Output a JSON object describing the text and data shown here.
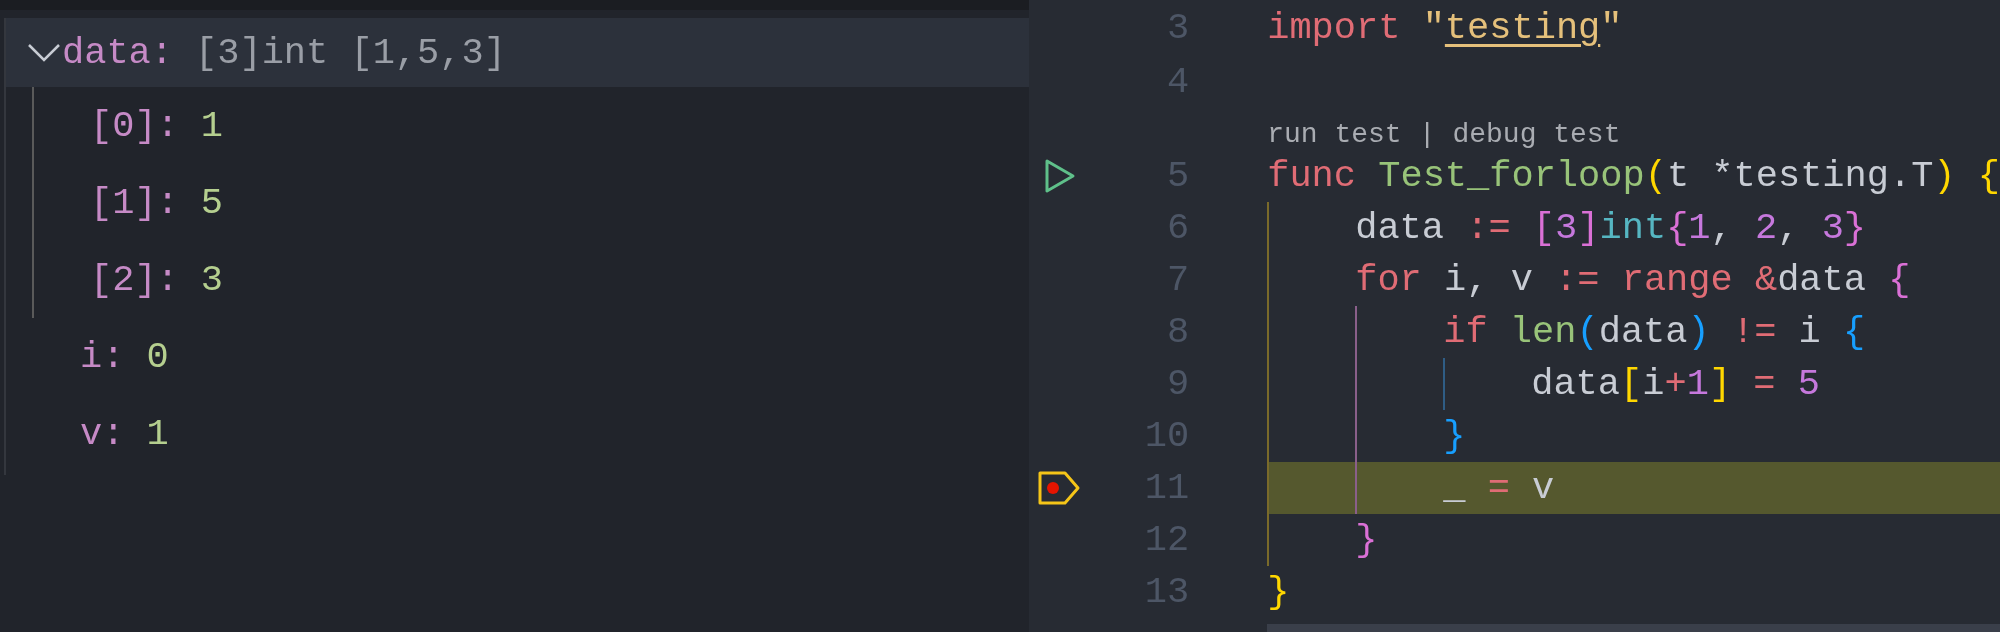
{
  "variables": [
    {
      "name": "data:",
      "value": "[3]int [1,5,3]",
      "kind": "summary",
      "expanded": true,
      "selected": true,
      "children": [
        {
          "name": "[0]:",
          "value": "1",
          "kind": "number",
          "selected": false
        },
        {
          "name": "[1]:",
          "value": "5",
          "kind": "number",
          "selected": false
        },
        {
          "name": "[2]:",
          "value": "3",
          "kind": "number",
          "selected": false
        }
      ]
    },
    {
      "name": "i:",
      "value": "0",
      "kind": "number",
      "selected": false
    },
    {
      "name": "v:",
      "value": "1",
      "kind": "number",
      "selected": false
    }
  ],
  "editor": {
    "lines": [
      {
        "number": "3",
        "tokens": [
          {
            "text": "import ",
            "kind": "keyword"
          },
          {
            "text": "\"",
            "kind": "string"
          },
          {
            "text": "testing",
            "kind": "link"
          },
          {
            "text": "\"",
            "kind": "string"
          }
        ]
      },
      {
        "number": "4"
      },
      {
        "kind": "codelens",
        "items": [
          {
            "text": "run test",
            "kind": "link"
          },
          {
            "text": "|",
            "kind": "separator"
          },
          {
            "text": "debug test",
            "kind": "link"
          }
        ]
      },
      {
        "number": "5",
        "runnable": true,
        "tokens": [
          {
            "text": "func ",
            "kind": "keyword"
          },
          {
            "text": "Test_forloop",
            "kind": "function"
          },
          {
            "text": "(",
            "kind": "bracket1"
          },
          {
            "text": "t *testing.T",
            "kind": "plain"
          },
          {
            "text": ")",
            "kind": "bracket1"
          },
          {
            "text": " {",
            "kind": "bracket1"
          }
        ],
        "children": [
          {
            "number": "6",
            "tokens": [
              {
                "text": "data ",
                "kind": "plain"
              },
              {
                "text": ":= ",
                "kind": "operator"
              },
              {
                "text": "[",
                "kind": "bracket2"
              },
              {
                "text": "3",
                "kind": "number"
              },
              {
                "text": "]",
                "kind": "bracket2"
              },
              {
                "text": "int",
                "kind": "type"
              },
              {
                "text": "{",
                "kind": "bracket2"
              },
              {
                "text": "1",
                "kind": "number"
              },
              {
                "text": ", ",
                "kind": "plain"
              },
              {
                "text": "2",
                "kind": "number"
              },
              {
                "text": ", ",
                "kind": "plain"
              },
              {
                "text": "3",
                "kind": "number"
              },
              {
                "text": "}",
                "kind": "bracket2"
              }
            ]
          },
          {
            "number": "7",
            "tokens": [
              {
                "text": "for",
                "kind": "keyword"
              },
              {
                "text": " i, v ",
                "kind": "plain"
              },
              {
                "text": ":= ",
                "kind": "operator"
              },
              {
                "text": "range ",
                "kind": "keyword"
              },
              {
                "text": "&",
                "kind": "operator"
              },
              {
                "text": "data ",
                "kind": "plain"
              },
              {
                "text": "{",
                "kind": "bracket2"
              }
            ],
            "children": [
              {
                "number": "8",
                "tokens": [
                  {
                    "text": "if ",
                    "kind": "keyword"
                  },
                  {
                    "text": "len",
                    "kind": "function"
                  },
                  {
                    "text": "(",
                    "kind": "bracket3"
                  },
                  {
                    "text": "data",
                    "kind": "plain"
                  },
                  {
                    "text": ") ",
                    "kind": "bracket3"
                  },
                  {
                    "text": "!=",
                    "kind": "operator"
                  },
                  {
                    "text": " i ",
                    "kind": "plain"
                  },
                  {
                    "text": "{",
                    "kind": "bracket3"
                  }
                ],
                "children": [
                  {
                    "number": "9",
                    "tokens": [
                      {
                        "text": "data",
                        "kind": "plain"
                      },
                      {
                        "text": "[",
                        "kind": "bracket1"
                      },
                      {
                        "text": "i",
                        "kind": "plain"
                      },
                      {
                        "text": "+",
                        "kind": "operator"
                      },
                      {
                        "text": "1",
                        "kind": "number"
                      },
                      {
                        "text": "] ",
                        "kind": "bracket1"
                      },
                      {
                        "text": "= ",
                        "kind": "operator"
                      },
                      {
                        "text": "5",
                        "kind": "number"
                      }
                    ]
                  }
                ]
              },
              {
                "number": "10",
                "tokens": [
                  {
                    "text": "}",
                    "kind": "bracket3"
                  }
                ]
              },
              {
                "number": "11",
                "paused": true,
                "tokens": [
                  {
                    "text": "_ ",
                    "kind": "plain"
                  },
                  {
                    "text": "=",
                    "kind": "operator"
                  },
                  {
                    "text": " v",
                    "kind": "plain"
                  }
                ]
              }
            ]
          },
          {
            "number": "12",
            "tokens": [
              {
                "text": "}",
                "kind": "bracket2"
              }
            ]
          }
        ]
      },
      {
        "number": "13",
        "tokens": [
          {
            "text": "}",
            "kind": "bracket1"
          }
        ]
      }
    ]
  }
}
